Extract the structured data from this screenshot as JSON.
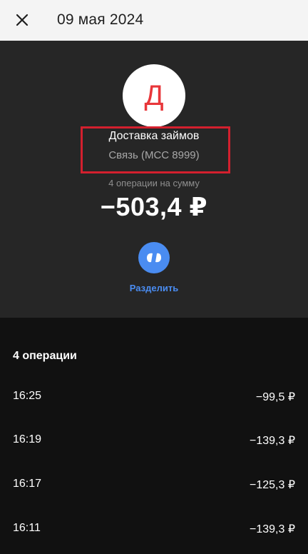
{
  "header": {
    "close_icon": "close-icon",
    "title": "09 мая 2024"
  },
  "merchant": {
    "avatar_letter": "Д",
    "name": "Доставка займов",
    "category": "Связь (MCC 8999)",
    "highlight_color": "#d3202e",
    "avatar_letter_color": "#e8363a"
  },
  "summary": {
    "operations_caption": "4 операции на сумму",
    "total": "−503,4 ₽"
  },
  "split": {
    "icon": "split-icon",
    "label": "Разделить",
    "color": "#4a8cf1"
  },
  "operations": {
    "heading": "4 операции",
    "items": [
      {
        "time": "16:25",
        "amount": "−99,5 ₽"
      },
      {
        "time": "16:19",
        "amount": "−139,3 ₽"
      },
      {
        "time": "16:17",
        "amount": "−125,3 ₽"
      },
      {
        "time": "16:11",
        "amount": "−139,3 ₽"
      }
    ]
  }
}
